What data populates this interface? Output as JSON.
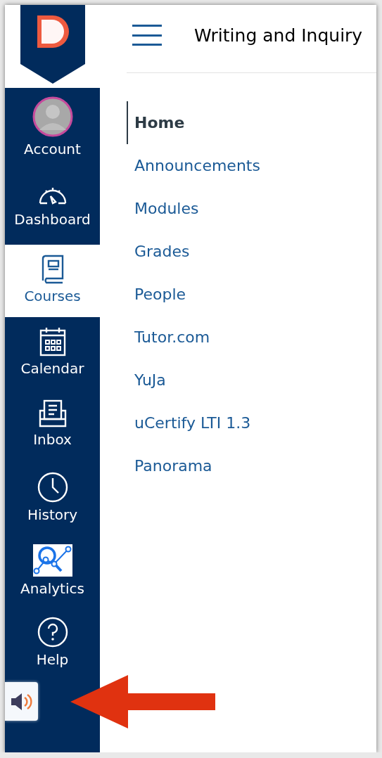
{
  "header": {
    "title": "Writing and Inquiry"
  },
  "global_nav": [
    {
      "label": "Account",
      "selected": false
    },
    {
      "label": "Dashboard",
      "selected": false
    },
    {
      "label": "Courses",
      "selected": true
    },
    {
      "label": "Calendar",
      "selected": false
    },
    {
      "label": "Inbox",
      "selected": false
    },
    {
      "label": "History",
      "selected": false
    },
    {
      "label": "Analytics",
      "selected": false
    },
    {
      "label": "Help",
      "selected": false
    }
  ],
  "course_nav": [
    {
      "label": "Home",
      "selected": true
    },
    {
      "label": "Announcements",
      "selected": false
    },
    {
      "label": "Modules",
      "selected": false
    },
    {
      "label": "Grades",
      "selected": false
    },
    {
      "label": "People",
      "selected": false
    },
    {
      "label": "Tutor.com",
      "selected": false
    },
    {
      "label": "YuJa",
      "selected": false
    },
    {
      "label": "uCertify LTI 1.3",
      "selected": false
    },
    {
      "label": "Panorama",
      "selected": false
    }
  ]
}
